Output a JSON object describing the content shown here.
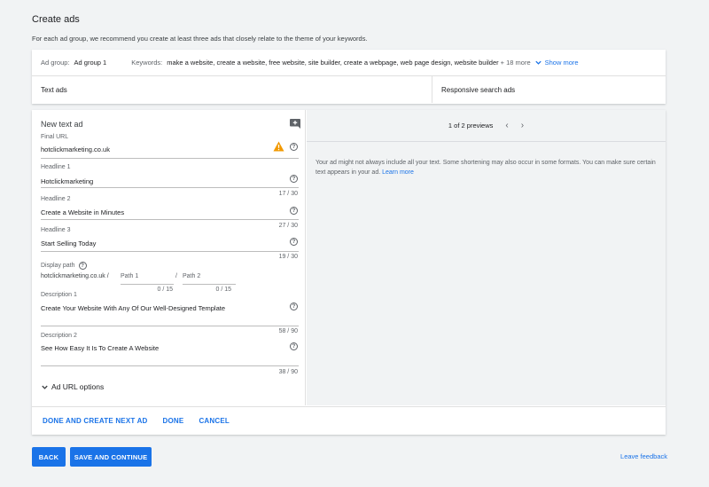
{
  "page": {
    "title": "Create ads",
    "subtitle": "For each ad group, we recommend you create at least three ads that closely relate to the theme of your keywords."
  },
  "adgroup": {
    "label": "Ad group:",
    "value": "Ad group 1",
    "keywords_label": "Keywords:",
    "keywords_value": "make a website, create a website, free website, site builder, create a webpage, web page design, website builder",
    "more": "+ 18 more",
    "show_more": "Show more"
  },
  "tabs": {
    "text_ads": "Text ads",
    "responsive": "Responsive search ads"
  },
  "editor": {
    "title": "New text ad",
    "final_url_label": "Final URL",
    "final_url_value": "hotclickmarketing.co.uk",
    "headline1_label": "Headline 1",
    "headline1_value": "Hotclickmarketing",
    "headline1_count": "17 / 30",
    "headline2_label": "Headline 2",
    "headline2_value": "Create a Website in Minutes",
    "headline2_count": "27 / 30",
    "headline3_label": "Headline 3",
    "headline3_value": "Start Selling Today",
    "headline3_count": "19 / 30",
    "display_path_label": "Display path",
    "display_path_base": "hotclickmarketing.co.uk /",
    "path1_placeholder": "Path 1",
    "path_sep": "/",
    "path2_placeholder": "Path 2",
    "path1_count": "0 / 15",
    "path2_count": "0 / 15",
    "desc1_label": "Description 1",
    "desc1_value": "Create Your Website With Any Of Our Well-Designed Template",
    "desc1_count": "58 / 90",
    "desc2_label": "Description 2",
    "desc2_value": "See How Easy It Is To Create A Website",
    "desc2_count": "38 / 90",
    "url_options": "Ad URL options",
    "help_glyph": "?"
  },
  "preview": {
    "counter": "1 of 2 previews",
    "prev": "‹",
    "next": "›",
    "note": "Your ad might not always include all your text. Some shortening may also occur in some formats. You can make sure certain text appears in your ad.",
    "learn_more": "Learn more"
  },
  "actions": {
    "done_next": "DONE AND CREATE NEXT AD",
    "done": "DONE",
    "cancel": "CANCEL"
  },
  "footer": {
    "back": "BACK",
    "save": "SAVE AND CONTINUE",
    "feedback": "Leave feedback"
  },
  "colors": {
    "accent": "#1a73e8",
    "warning": "#f29900",
    "background": "#f1f3f4"
  }
}
